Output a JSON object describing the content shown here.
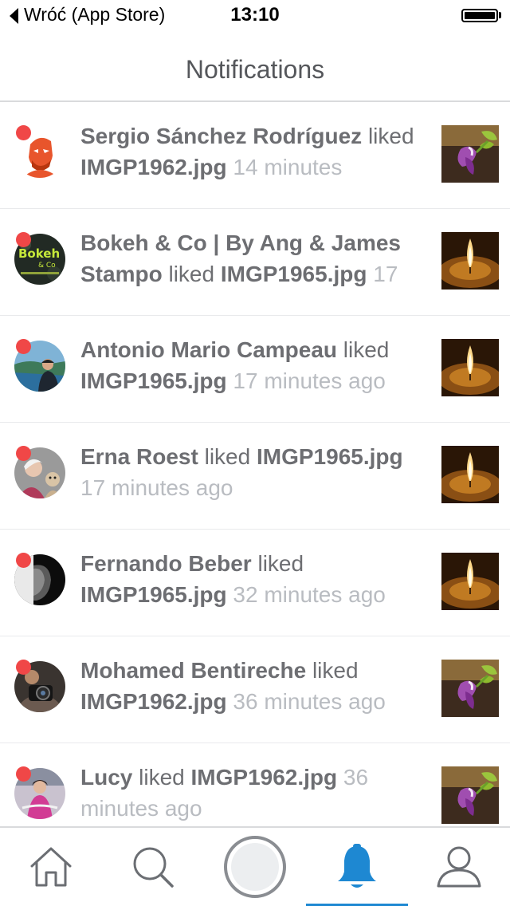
{
  "status_bar": {
    "back_label": "Wróć (App Store)",
    "time": "13:10"
  },
  "header": {
    "title": "Notifications"
  },
  "notifications": [
    {
      "user": "Sergio Sánchez Rodríguez",
      "action": "liked",
      "file": "IMGP1962.jpg",
      "time": "14 minutes"
    },
    {
      "user": "Bokeh & Co | By Ang & James Stampo",
      "action": "liked",
      "file": "IMGP1965.jpg",
      "time": "17"
    },
    {
      "user": "Antonio Mario Campeau",
      "action": "liked",
      "file": "IMGP1965.jpg",
      "time": "17 minutes ago"
    },
    {
      "user": "Erna Roest",
      "action": "liked",
      "file": "IMGP1965.jpg",
      "time": "17 minutes ago"
    },
    {
      "user": "Fernando Beber",
      "action": "liked",
      "file": "IMGP1965.jpg",
      "time": "32 minutes ago"
    },
    {
      "user": "Mohamed Bentireche",
      "action": "liked",
      "file": "IMGP1962.jpg",
      "time": "36 minutes ago"
    },
    {
      "user": "Lucy",
      "action": "liked",
      "file": "IMGP1962.jpg",
      "time": "36 minutes ago"
    }
  ],
  "tab_bar": {
    "tabs": [
      "home-icon",
      "search-icon",
      "camera-shutter-icon",
      "bell-icon",
      "profile-icon"
    ],
    "active_tab": "bell-icon"
  },
  "colors": {
    "unread_dot": "#f04747",
    "active_tab": "#1e88d2",
    "text": "#6d6e72",
    "muted_time": "#b9bcc1"
  }
}
